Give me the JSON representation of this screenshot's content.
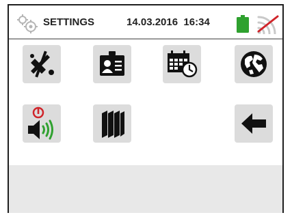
{
  "header": {
    "title": "SETTINGS",
    "date": "14.03.2016",
    "time": "16:34",
    "icons": [
      "gear-icon",
      "battery-icon",
      "no-signal-icon"
    ],
    "battery_color": "#2fa12f",
    "no_signal_color": "#d0242a"
  },
  "menu": {
    "items": [
      {
        "name": "tile-tools",
        "icon": "wrench-screwdriver-icon"
      },
      {
        "name": "tile-operator",
        "icon": "id-badge-icon"
      },
      {
        "name": "tile-date-time",
        "icon": "calendar-clock-icon"
      },
      {
        "name": "tile-language",
        "icon": "globe-icon"
      },
      {
        "name": "tile-sound",
        "icon": "speaker-power-icon"
      },
      {
        "name": "tile-info",
        "icon": "books-icon"
      },
      {
        "name": "tile-back",
        "icon": "back-arrow-icon"
      }
    ],
    "tile_color": "#dcdcdc",
    "accent_red": "#d0242a",
    "accent_green": "#2fa12f"
  }
}
